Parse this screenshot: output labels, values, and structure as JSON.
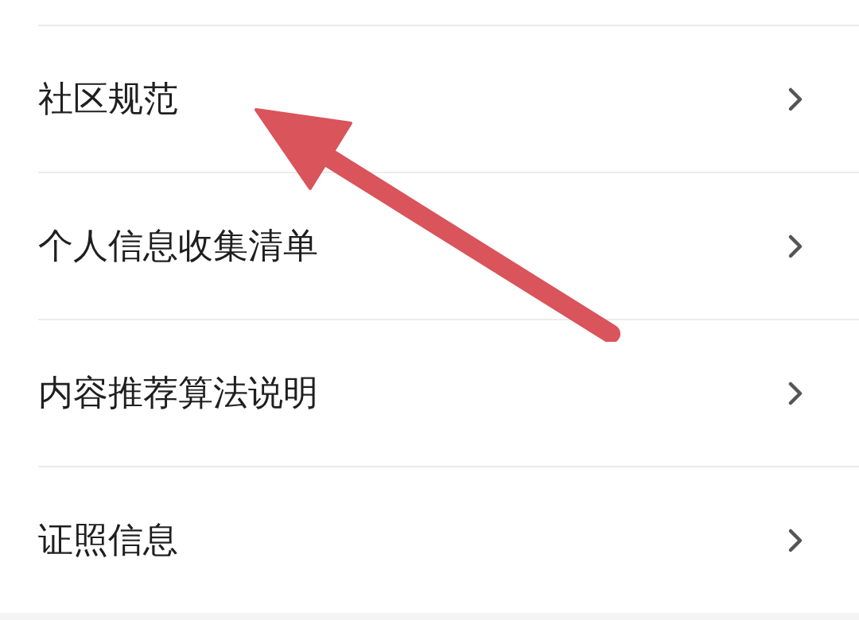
{
  "menu_items": [
    {
      "label": "社区规范"
    },
    {
      "label": "个人信息收集清单"
    },
    {
      "label": "内容推荐算法说明"
    },
    {
      "label": "证照信息"
    }
  ]
}
